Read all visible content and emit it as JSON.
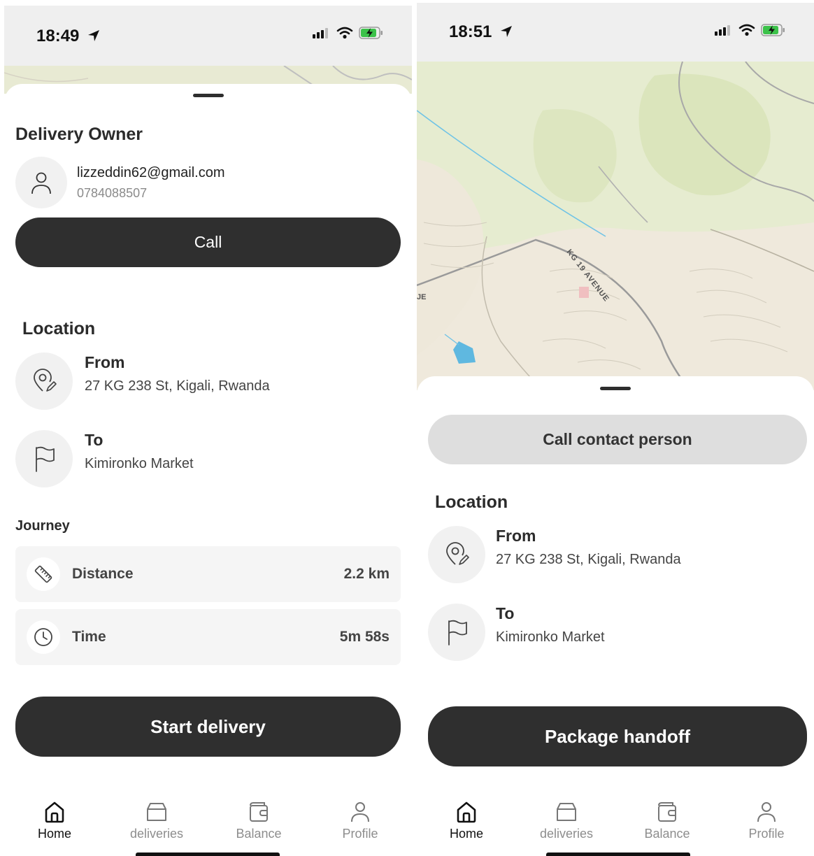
{
  "left_screen": {
    "status": {
      "time": "18:49"
    },
    "owner": {
      "heading": "Delivery Owner",
      "email": "lizzeddin62@gmail.com",
      "phone": "0784088507",
      "call_label": "Call"
    },
    "location": {
      "heading": "Location",
      "from_label": "From",
      "from_value": "27 KG 238 St, Kigali, Rwanda",
      "to_label": "To",
      "to_value": "Kimironko Market"
    },
    "journey": {
      "heading": "Journey",
      "rows": [
        {
          "label": "Distance",
          "value": "2.2 km",
          "icon": "ruler-icon"
        },
        {
          "label": "Time",
          "value": "5m 58s",
          "icon": "clock-icon"
        }
      ]
    },
    "primary_action": "Start delivery"
  },
  "right_screen": {
    "status": {
      "time": "18:51"
    },
    "map": {
      "road_label": "KG 19 AVENUE",
      "edge_label": "JE"
    },
    "contact_button": "Call contact person",
    "location": {
      "heading": "Location",
      "from_label": "From",
      "from_value": "27 KG 238 St, Kigali, Rwanda",
      "to_label": "To",
      "to_value": "Kimironko Market"
    },
    "primary_action": "Package handoff"
  },
  "tabbar": {
    "active": "Home",
    "items": [
      {
        "label": "Home",
        "icon": "home-icon"
      },
      {
        "label": "deliveries",
        "icon": "box-icon"
      },
      {
        "label": "Balance",
        "icon": "wallet-icon"
      },
      {
        "label": "Profile",
        "icon": "user-icon"
      }
    ]
  },
  "colors": {
    "dark_button": "#2f2f2f",
    "grey_button": "#dedede",
    "icon_circle": "#f1f1f1",
    "map_green": "#dfe8c2",
    "map_beige": "#efe9dc",
    "water": "#5fb8e0"
  }
}
